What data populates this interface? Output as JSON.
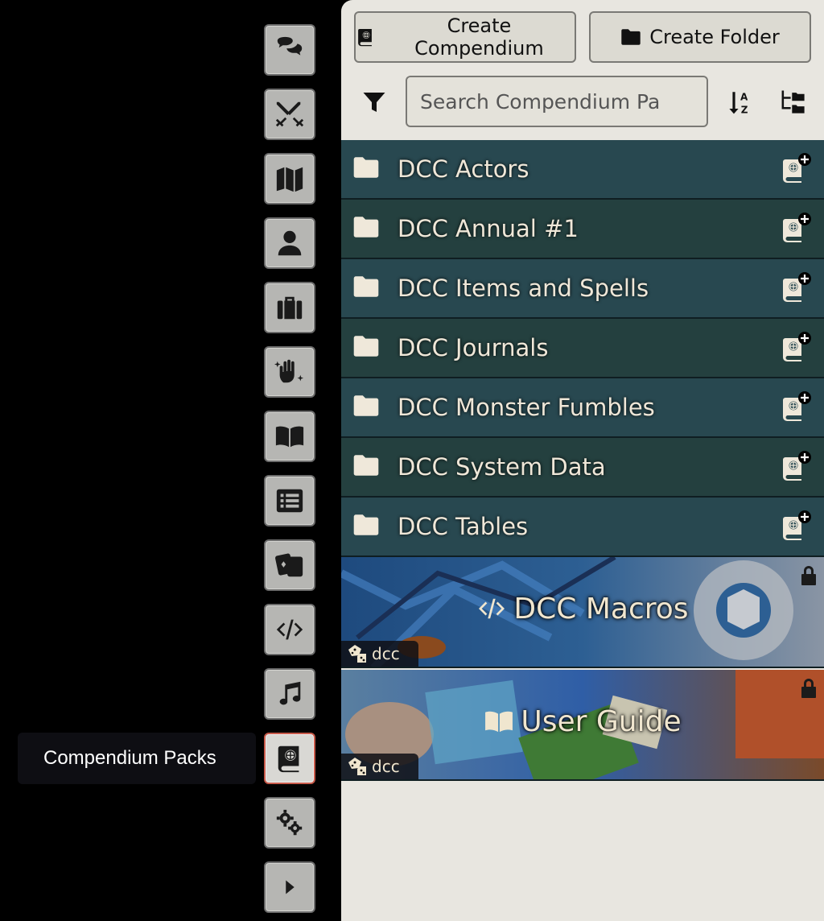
{
  "sidebar": {
    "tabs": [
      {
        "name": "chat-tab",
        "icon": "comments-icon"
      },
      {
        "name": "combat-tab",
        "icon": "crossed-swords-icon"
      },
      {
        "name": "scenes-tab",
        "icon": "map-icon"
      },
      {
        "name": "actors-tab",
        "icon": "user-icon"
      },
      {
        "name": "items-tab",
        "icon": "suitcase-icon"
      },
      {
        "name": "effects-tab",
        "icon": "hand-sparkles-icon"
      },
      {
        "name": "journal-tab",
        "icon": "book-open-icon"
      },
      {
        "name": "tables-tab",
        "icon": "list-icon"
      },
      {
        "name": "cards-tab",
        "icon": "cards-icon"
      },
      {
        "name": "macros-tab",
        "icon": "code-icon"
      },
      {
        "name": "playlists-tab",
        "icon": "music-icon"
      },
      {
        "name": "compendium-tab",
        "icon": "atlas-icon",
        "active": true
      },
      {
        "name": "settings-tab",
        "icon": "cogs-icon"
      },
      {
        "name": "collapse-tab",
        "icon": "caret-right-icon"
      }
    ],
    "tooltip": "Compendium Packs"
  },
  "header": {
    "create_compendium": "Create Compendium",
    "create_folder": "Create Folder",
    "search_placeholder": "Search Compendium Pa"
  },
  "folders": [
    {
      "label": "DCC Actors"
    },
    {
      "label": "DCC Annual #1"
    },
    {
      "label": "DCC Items and Spells"
    },
    {
      "label": "DCC Journals"
    },
    {
      "label": "DCC Monster Fumbles"
    },
    {
      "label": "DCC System Data"
    },
    {
      "label": "DCC Tables"
    }
  ],
  "packs": [
    {
      "title": "DCC Macros",
      "system": "dcc",
      "icon": "code-icon",
      "locked": true
    },
    {
      "title": "User Guide",
      "system": "dcc",
      "icon": "book-open-icon",
      "locked": true
    }
  ],
  "colors": {
    "folder_bg": "#284850",
    "panel_bg": "#e8e6e0",
    "active_border": "#c85a4a"
  }
}
